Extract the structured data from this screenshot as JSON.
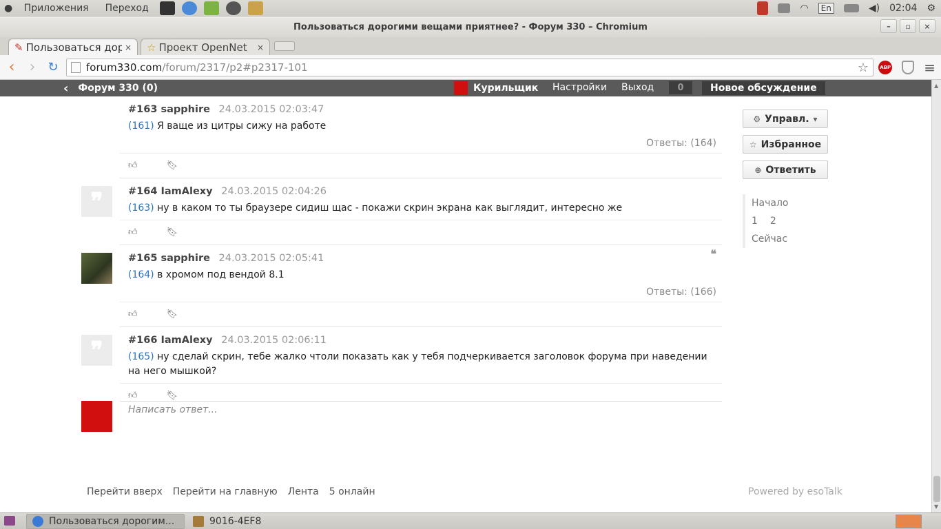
{
  "system_panel": {
    "apps_label": "Приложения",
    "places_label": "Переход",
    "lang": "En",
    "clock": "02:04"
  },
  "window": {
    "title": "Пользоваться дорогими вещами приятнее? - Форум 330 – Chromium"
  },
  "tabs": [
    {
      "title": "Пользоваться дорогими вещами приятнее? - Форум 330",
      "close": "×"
    },
    {
      "title": "Проект OpenNet",
      "close": "×"
    }
  ],
  "toolbar": {
    "url_host": "forum330.com",
    "url_path": "/forum/2317/p2#p2317-101",
    "abp": "ABP"
  },
  "forum_header": {
    "title": "Форум 330  (0)",
    "username": "Курильщик",
    "settings": "Настройки",
    "logout": "Выход",
    "count": "0",
    "new_discussion": "Новое обсуждение"
  },
  "posts": [
    {
      "num": "#163",
      "author": "sapphire",
      "date": "24.03.2015 02:03:47",
      "ref": "(161)",
      "text": "Я ваще из цитры сижу на работе",
      "replies": "Ответы: (164)"
    },
    {
      "num": "#164",
      "author": "IamAlexy",
      "date": "24.03.2015 02:04:26",
      "ref": "(163)",
      "text": "ну в каком то ты браузере сидиш щас - покажи скрин экрана как выглядит, интересно же",
      "replies": ""
    },
    {
      "num": "#165",
      "author": "sapphire",
      "date": "24.03.2015 02:05:41",
      "ref": "(164)",
      "text": "в хромом под вендой 8.1",
      "replies": "Ответы: (166)"
    },
    {
      "num": "#166",
      "author": "IamAlexy",
      "date": "24.03.2015 02:06:11",
      "ref": "(165)",
      "text": "ну сделай скрин, тебе жалко чтоли показать как у тебя подчеркивается заголовок форума при наведении на него мышкой?",
      "replies": ""
    }
  ],
  "reply": {
    "placeholder": "Написать ответ..."
  },
  "sidebar": {
    "manage": "Управл.",
    "favorite": "Избранное",
    "reply": "Ответить",
    "start": "Начало",
    "page1": "1",
    "page2": "2",
    "now": "Сейчас"
  },
  "footer": {
    "top": "Перейти вверх",
    "home": "Перейти на главную",
    "feed": "Лента",
    "online": "5 онлайн",
    "powered": "Powered by esoTalk"
  },
  "taskbar": {
    "item1": "Пользоваться дорогим...",
    "item2": "9016-4EF8"
  },
  "colors": {
    "link_blue": "#2a72c9",
    "header_gray": "#5a5a5a",
    "avatar_red": "#d10f0f"
  }
}
